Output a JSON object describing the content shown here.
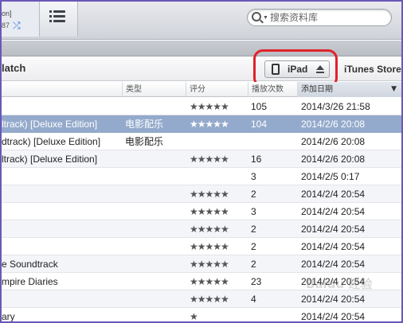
{
  "toolbar": {
    "now_playing_line1": "on]",
    "now_playing_line2": "87",
    "search_placeholder": "搜索资料库"
  },
  "header": {
    "title": "latch",
    "device_label": "iPad",
    "store_label": "iTunes Store"
  },
  "columns": {
    "genre": "类型",
    "rating": "评分",
    "plays": "播放次数",
    "date_added": "添加日期"
  },
  "rows": [
    {
      "name": "",
      "genre": "",
      "stars": "★★★★★",
      "plays": "105",
      "date": "2014/3/26 21:58"
    },
    {
      "name": "ltrack) [Deluxe Edition]",
      "genre": "电影配乐",
      "stars": "★★★★★",
      "plays": "104",
      "date": "2014/2/6 20:08"
    },
    {
      "name": "dtrack) [Deluxe Edition]",
      "genre": "电影配乐",
      "stars": "",
      "plays": "",
      "date": "2014/2/6 20:08"
    },
    {
      "name": "ltrack) [Deluxe Edition]",
      "genre": "",
      "stars": "★★★★★",
      "plays": "16",
      "date": "2014/2/6 20:08"
    },
    {
      "name": "",
      "genre": "",
      "stars": "",
      "plays": "3",
      "date": "2014/2/5 0:17"
    },
    {
      "name": "",
      "genre": "",
      "stars": "★★★★★",
      "plays": "2",
      "date": "2014/2/4 20:54"
    },
    {
      "name": "",
      "genre": "",
      "stars": "★★★★★",
      "plays": "3",
      "date": "2014/2/4 20:54"
    },
    {
      "name": "",
      "genre": "",
      "stars": "★★★★★",
      "plays": "2",
      "date": "2014/2/4 20:54"
    },
    {
      "name": "",
      "genre": "",
      "stars": "★★★★★",
      "plays": "2",
      "date": "2014/2/4 20:54"
    },
    {
      "name": "e Soundtrack",
      "genre": "",
      "stars": "★★★★★",
      "plays": "2",
      "date": "2014/2/4 20:54"
    },
    {
      "name": "mpire Diaries",
      "genre": "",
      "stars": "★★★★★",
      "plays": "23",
      "date": "2014/2/4 20:54"
    },
    {
      "name": "",
      "genre": "",
      "stars": "★★★★★",
      "plays": "4",
      "date": "2014/2/4 20:54"
    },
    {
      "name": "ary",
      "genre": "",
      "stars": "★",
      "plays": "",
      "date": "2014/2/4 20:54"
    }
  ],
  "selected_row": 1,
  "watermark": "Baidu 经验",
  "colors": {
    "selection": "#94aacc",
    "highlight_ring": "#e0222a",
    "frame": "#6b57b8"
  }
}
